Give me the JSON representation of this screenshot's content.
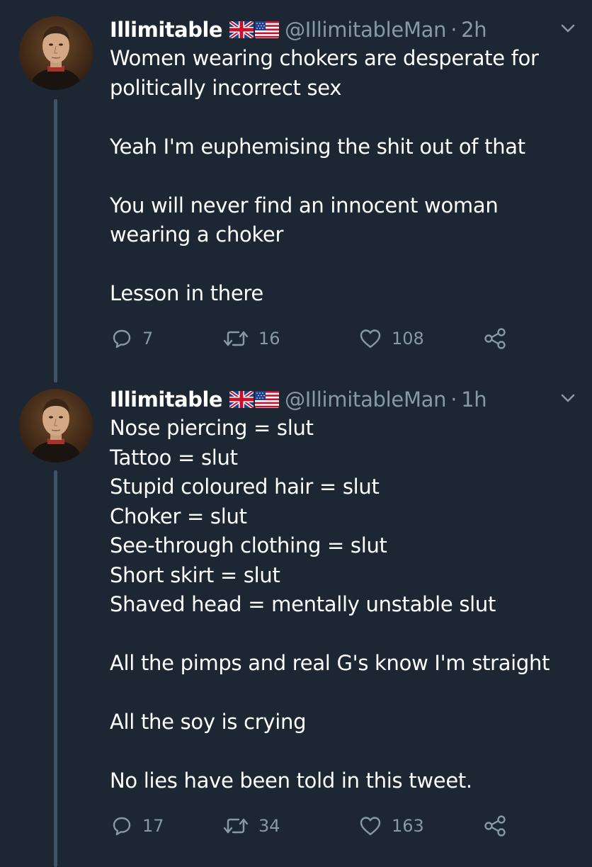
{
  "colors": {
    "background": "#1c2733",
    "text": "#ffffff",
    "muted": "#8899a6",
    "thread_line": "#3d5466"
  },
  "tweets": [
    {
      "author": {
        "display_name": "Illimitable",
        "flags": [
          "uk-flag-icon",
          "us-flag-icon"
        ],
        "handle": "@IllimitableMan",
        "separator": "·",
        "time": "2h"
      },
      "lines": [
        "Women wearing chokers are desperate for",
        "politically incorrect sex",
        "",
        "Yeah I'm euphemising the shit out of that",
        "",
        "You will never find an innocent woman",
        "wearing a choker",
        "",
        "Lesson in there"
      ],
      "stats": {
        "replies": "7",
        "retweets": "16",
        "likes": "108"
      }
    },
    {
      "author": {
        "display_name": "Illimitable",
        "flags": [
          "uk-flag-icon",
          "us-flag-icon"
        ],
        "handle": "@IllimitableMan",
        "separator": "·",
        "time": "1h"
      },
      "lines": [
        "Nose piercing = slut",
        "Tattoo = slut",
        "Stupid coloured hair = slut",
        "Choker = slut",
        "See-through clothing = slut",
        "Short skirt = slut",
        "Shaved head = mentally unstable slut",
        "",
        "All the pimps and real G's know I'm straight",
        "",
        "All the soy is crying",
        "",
        "No lies have been told in this tweet."
      ],
      "stats": {
        "replies": "17",
        "retweets": "34",
        "likes": "163"
      }
    }
  ],
  "icons": {
    "reply": "reply-icon",
    "retweet": "retweet-icon",
    "like": "like-icon",
    "share": "share-icon",
    "menu": "chevron-down-icon"
  }
}
